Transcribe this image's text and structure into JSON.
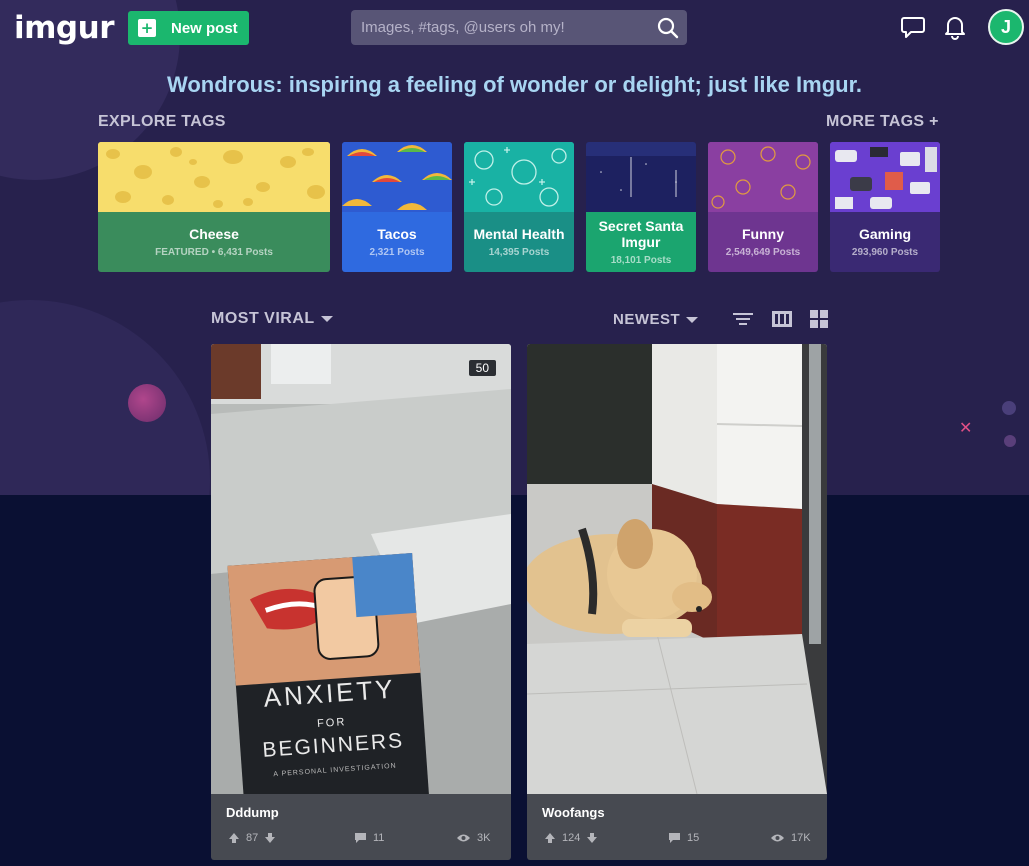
{
  "header": {
    "logo": "imgur",
    "new_post_label": "New post",
    "search_placeholder": "Images, #tags, @users oh my!",
    "avatar_initial": "J"
  },
  "tagline": "Wondrous: inspiring a feeling of wonder or delight; just like Imgur.",
  "explore": {
    "label": "EXPLORE TAGS",
    "more_label": "MORE TAGS +",
    "tags": [
      {
        "name": "Cheese",
        "count": "FEATURED • 6,431 Posts"
      },
      {
        "name": "Tacos",
        "count": "2,321 Posts"
      },
      {
        "name": "Mental Health",
        "count": "14,395 Posts"
      },
      {
        "name": "Secret Santa Imgur",
        "count": "18,101 Posts"
      },
      {
        "name": "Funny",
        "count": "2,549,649 Posts"
      },
      {
        "name": "Gaming",
        "count": "293,960 Posts"
      }
    ]
  },
  "sort": {
    "section": "MOST VIRAL",
    "order": "NEWEST"
  },
  "posts": [
    {
      "title": "Dddump",
      "badge": "50",
      "upvotes": "87",
      "comments": "11",
      "views": "3K",
      "book_title_1": "ANXIETY",
      "book_title_2": "FOR",
      "book_title_3": "BEGINNERS",
      "book_subtitle": "A PERSONAL INVESTIGATION"
    },
    {
      "title": "Woofangs",
      "upvotes": "124",
      "comments": "15",
      "views": "17K"
    }
  ]
}
